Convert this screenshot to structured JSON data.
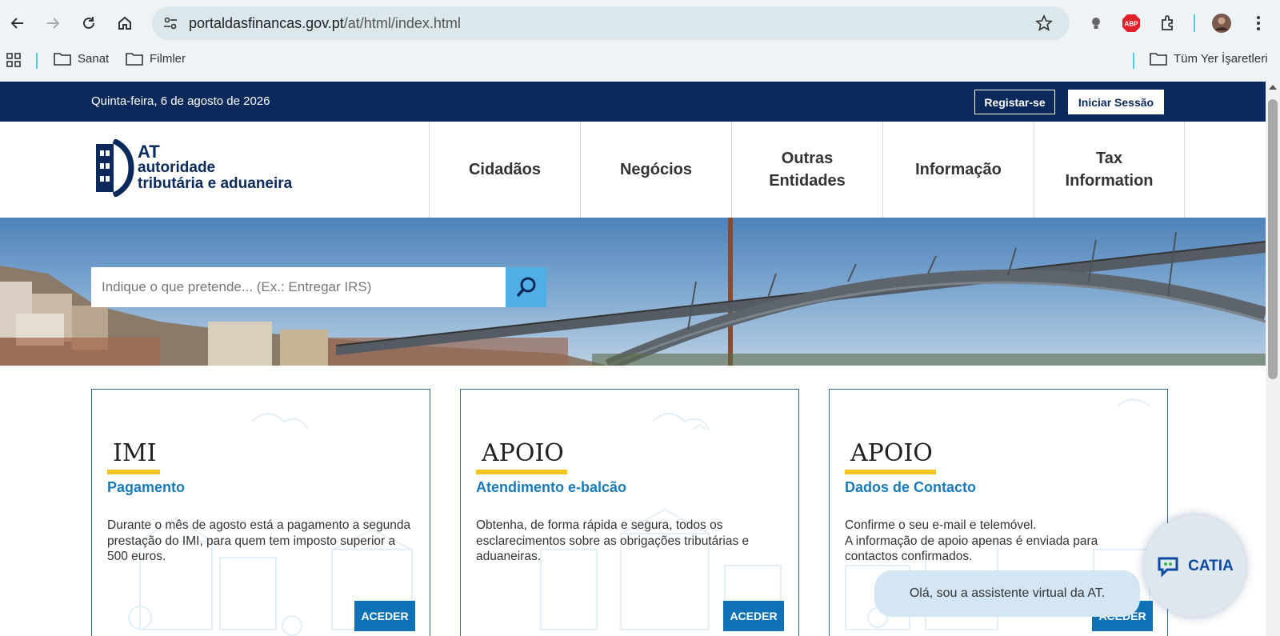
{
  "browser": {
    "url_host": "portaldasfinancas.gov.pt",
    "url_path": "/at/html/index.html",
    "bookmarks": [
      "Sanat",
      "Filmler"
    ],
    "all_bookmarks": "Tüm Yer İşaretleri",
    "extension_badge": "ABP"
  },
  "topbar": {
    "date": "Quinta-feira, 6 de agosto de 2026",
    "register_label": "Registar-se",
    "login_label": "Iniciar Sessão"
  },
  "header": {
    "logo_line1": "AT",
    "logo_line2": "autoridade",
    "logo_line3": "tributária e aduaneira",
    "nav": [
      {
        "label": "Cidadãos"
      },
      {
        "label": "Negócios"
      },
      {
        "label": "Outras Entidades"
      },
      {
        "label": "Informação"
      },
      {
        "label": "Tax Information"
      }
    ]
  },
  "hero": {
    "search_placeholder": "Indique o que pretende... (Ex.: Entregar IRS)"
  },
  "cards": [
    {
      "title": "IMI",
      "subtitle": "Pagamento",
      "body": "Durante o mês de agosto está a pagamento a segunda prestação do IMI, para quem tem imposto superior a 500 euros.",
      "button": "ACEDER"
    },
    {
      "title": "APOIO",
      "subtitle": "Atendimento e-balcão",
      "body": "Obtenha, de forma rápida e segura, todos os esclarecimentos sobre as obrigações tributárias e aduaneiras.",
      "button": "ACEDER"
    },
    {
      "title": "APOIO",
      "subtitle": "Dados de Contacto",
      "body": "Confirme o seu e-mail e telemóvel.\nA informação de apoio apenas é enviada para contactos confirmados.",
      "button": "ACEDER"
    }
  ],
  "chatbot": {
    "greeting": "Olá, sou a assistente virtual da AT.",
    "name": "CATIA"
  },
  "colors": {
    "topbar": "#0b2a5b",
    "accent_blue": "#1a7ab7",
    "button_blue": "#0f72b6",
    "underline_yellow": "#f3c419",
    "search_button": "#50aee4"
  }
}
